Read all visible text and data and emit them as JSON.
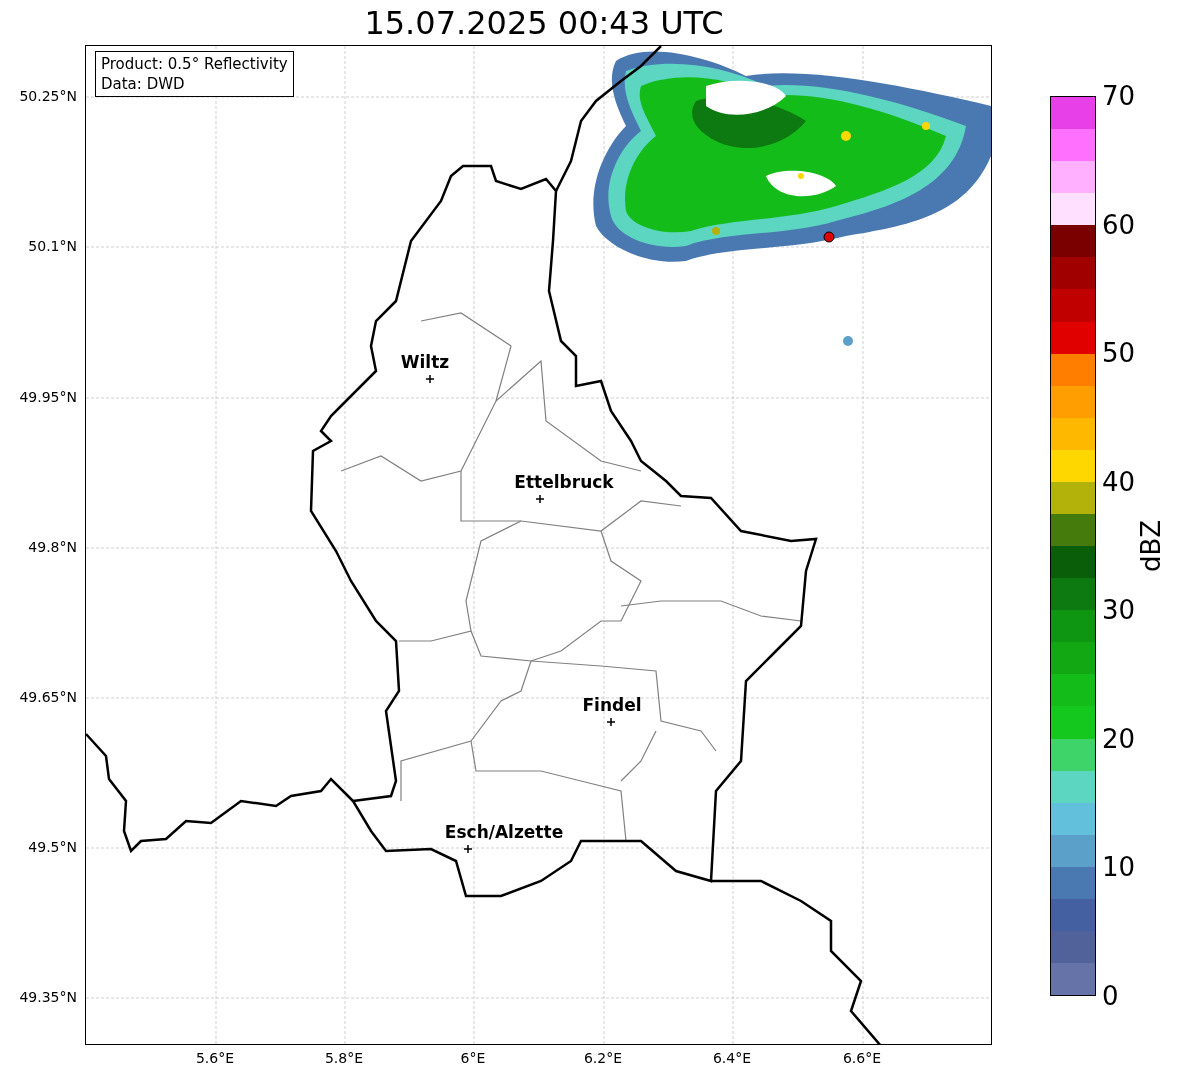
{
  "title": "15.07.2025 00:43 UTC",
  "info_box": {
    "lines": [
      "Product: 0.5° Reflectivity",
      "Data: DWD"
    ]
  },
  "map": {
    "latitude_labels": [
      "50.25°N",
      "50.1°N",
      "49.95°N",
      "49.8°N",
      "49.65°N",
      "49.5°N",
      "49.35°N"
    ],
    "longitude_labels": [
      "5.6°E",
      "5.8°E",
      "6°E",
      "6.2°E",
      "6.4°E",
      "6.6°E"
    ],
    "cities": [
      {
        "name": "Wiltz"
      },
      {
        "name": "Ettelbruck"
      },
      {
        "name": "Findel"
      },
      {
        "name": "Esch/Alzette"
      }
    ]
  },
  "colorbar": {
    "label": "dBZ",
    "ticks": [
      "70",
      "60",
      "50",
      "40",
      "30",
      "20",
      "10",
      "0"
    ],
    "bins": [
      {
        "color": "#e840e8"
      },
      {
        "color": "#ff70ff"
      },
      {
        "color": "#ffb0ff"
      },
      {
        "color": "#ffe0ff"
      },
      {
        "color": "#7a0000"
      },
      {
        "color": "#a00000"
      },
      {
        "color": "#c00000"
      },
      {
        "color": "#e00000"
      },
      {
        "color": "#ff7e00"
      },
      {
        "color": "#ff9e00"
      },
      {
        "color": "#ffb800"
      },
      {
        "color": "#ffd700"
      },
      {
        "color": "#b2b20a"
      },
      {
        "color": "#457a0c"
      },
      {
        "color": "#0a5e0a"
      },
      {
        "color": "#0c7a10"
      },
      {
        "color": "#0e9612"
      },
      {
        "color": "#12a814"
      },
      {
        "color": "#14bc1a"
      },
      {
        "color": "#14c81e"
      },
      {
        "color": "#3ed46a"
      },
      {
        "color": "#5cd6c0"
      },
      {
        "color": "#62c0dc"
      },
      {
        "color": "#5aa0c8"
      },
      {
        "color": "#4a78b0"
      },
      {
        "color": "#4460a0"
      },
      {
        "color": "#51629b"
      },
      {
        "color": "#6673a8"
      }
    ]
  }
}
